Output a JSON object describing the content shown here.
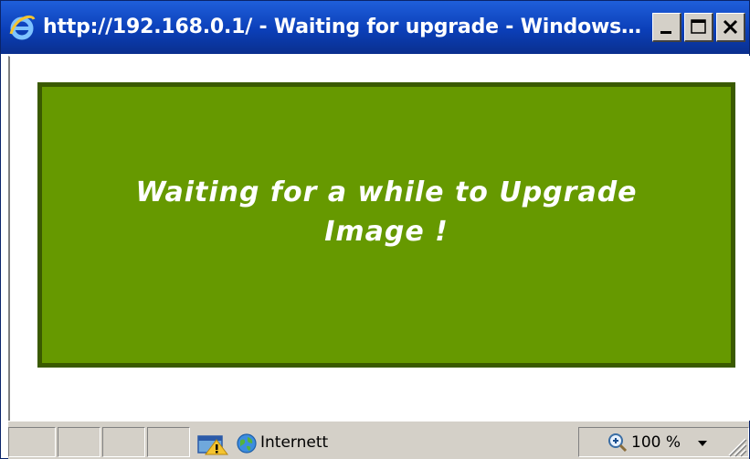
{
  "window": {
    "title": "http://192.168.0.1/ - Waiting for upgrade - Windows Inte...",
    "titlebar_color": "#0b3fb8",
    "icon": "ie-icon",
    "buttons": [
      {
        "name": "minimize-button",
        "icon": "minimize-icon"
      },
      {
        "name": "maximize-button",
        "icon": "maximize-icon"
      },
      {
        "name": "close-button",
        "icon": "close-icon"
      }
    ]
  },
  "page": {
    "message": "Waiting for a while to Upgrade Image !",
    "panel_color": "#669900",
    "panel_border_color": "#3a5a00",
    "text_color": "#ffffff"
  },
  "statusbar": {
    "security_icon": "popup-blocked-icon",
    "zone_icon": "globe-icon",
    "zone_label": "Internett",
    "zoom_icon": "zoom-icon",
    "zoom_label": "100 %",
    "zoom_dropdown_icon": "chevron-down-icon",
    "resize_grip_icon": "resize-grip-icon"
  }
}
